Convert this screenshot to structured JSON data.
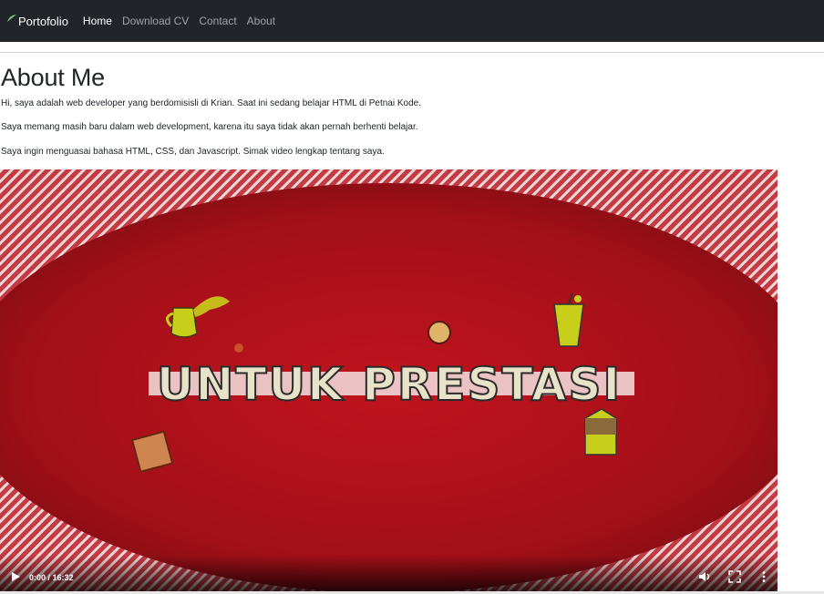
{
  "navbar": {
    "brand": "Portofolio",
    "links": [
      {
        "label": "Home",
        "active": true
      },
      {
        "label": "Download CV",
        "active": false
      },
      {
        "label": "Contact",
        "active": false
      },
      {
        "label": "About",
        "active": false
      }
    ]
  },
  "about": {
    "title": "About Me",
    "paragraphs": [
      "Hi, saya adalah web developer yang berdomisisli di Krian. Saat ini sedang belajar HTML di Petnai Kode.",
      "Saya memang masih baru dalam web development, karena itu saya tidak akan pernah berhenti belajar.",
      "Saya ingin menguasai bahasa HTML, CSS, dan Javascript. Simak video lengkap tentang saya."
    ]
  },
  "video": {
    "frame_text": "UNTUK PRESTASI",
    "time": "0:00 / 16:32",
    "icons": [
      "play-icon",
      "volume-icon",
      "fullscreen-icon",
      "more-options-icon"
    ]
  },
  "colors": {
    "navbar_bg": "#212529",
    "video_red": "#b3121c",
    "accent_yellow": "#c8cf1a"
  }
}
